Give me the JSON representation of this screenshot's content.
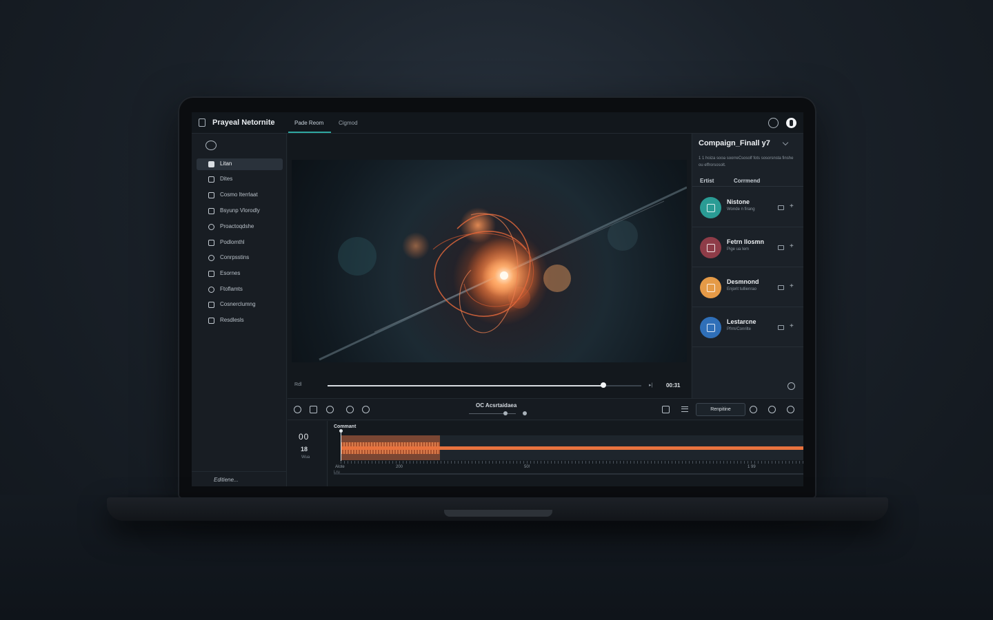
{
  "app": {
    "title": "Prayeal Netornite"
  },
  "tabs": [
    {
      "label": "Pade Reom"
    },
    {
      "label": "Cigmod"
    }
  ],
  "sidebar": {
    "items": [
      {
        "label": "Litan",
        "icon": "folder-icon"
      },
      {
        "label": "Dites",
        "icon": "chart-icon"
      },
      {
        "label": "Cosmo Iterrlaat",
        "icon": "home-icon"
      },
      {
        "label": "Bsyunp Vlorodly",
        "icon": "star-icon"
      },
      {
        "label": "Proactoqdshe",
        "icon": "clock-icon"
      },
      {
        "label": "Podlomthl",
        "icon": "window-icon"
      },
      {
        "label": "Conrpsstins",
        "icon": "globe-icon"
      },
      {
        "label": "Esornes",
        "icon": "image-icon"
      },
      {
        "label": "Ftoflamts",
        "icon": "circle-icon"
      },
      {
        "label": "Cosnerclumng",
        "icon": "triangle-icon"
      },
      {
        "label": "Resdlesls",
        "icon": "users-icon"
      }
    ],
    "footer": "Editiene..."
  },
  "player": {
    "left_label": "Rdl",
    "time": "00:31",
    "progress": 0.88
  },
  "panel": {
    "title": "Compaign_Finall y7",
    "description": "1 1 hoiza sooa soorreCsosolf fots sosorsnsta finshe ou effrorsosolt.",
    "tabs": [
      "Ertist",
      "Corrmend"
    ],
    "assets": [
      {
        "name": "Nistone",
        "sub": "Wonde n firang",
        "color": "#2a9b94",
        "icon": "media-icon"
      },
      {
        "name": "Fetrn Ilosmn",
        "sub": "Pige ua Iem",
        "color": "#8e3c48",
        "icon": "music-icon"
      },
      {
        "name": "Desmnond",
        "sub": "Enjorit tullienrao",
        "color": "#e59a47",
        "icon": "image-icon"
      },
      {
        "name": "Lestarcne",
        "sub": "Pfrm/Conrilte",
        "color": "#2f6fb8",
        "icon": "monitor-icon"
      }
    ]
  },
  "toolbar": {
    "center_label": "OC Acsrtaidaea",
    "zoom": 0.78,
    "button_label": "Renpitine"
  },
  "timeline": {
    "counter": "00",
    "frame": "18",
    "unit": "Wua",
    "track_label": "Commant",
    "ticks": [
      "Alote",
      "200",
      "50!",
      "1 99"
    ],
    "scroll_label": "Lru"
  },
  "colors": {
    "accent": "#2fa8a0",
    "waveform": "#e8723e"
  }
}
